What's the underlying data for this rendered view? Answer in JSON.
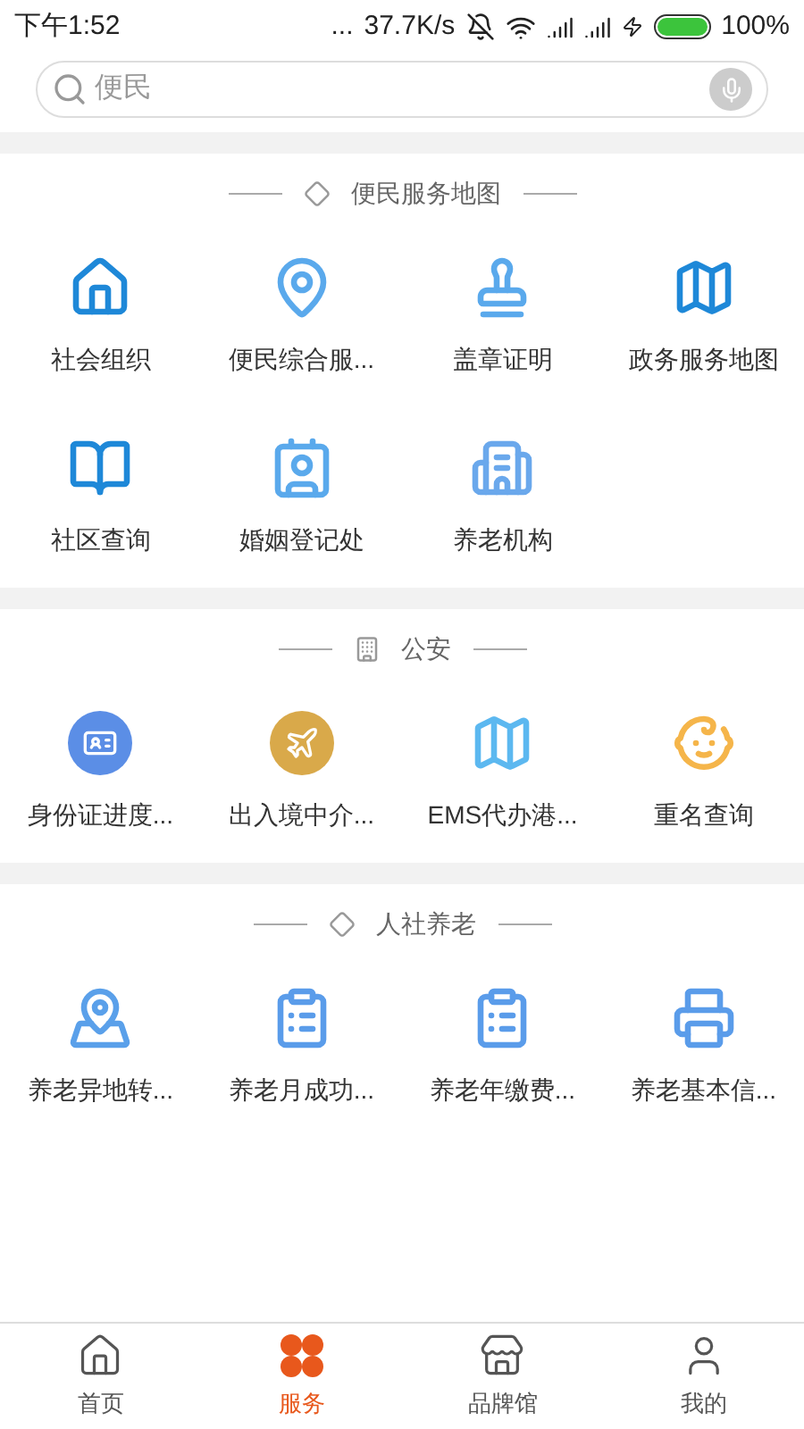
{
  "status_bar": {
    "time": "下午1:52",
    "dots": "...",
    "speed": "37.7K/s",
    "battery": "100%"
  },
  "search": {
    "placeholder": "便民"
  },
  "sections": [
    {
      "title": "便民服务地图",
      "items": [
        "社会组织",
        "便民综合服...",
        "盖章证明",
        "政务服务地图",
        "社区查询",
        "婚姻登记处",
        "养老机构"
      ]
    },
    {
      "title": "公安",
      "items": [
        "身份证进度...",
        "出入境中介...",
        "EMS代办港...",
        "重名查询"
      ]
    },
    {
      "title": "人社养老",
      "items": [
        "养老异地转...",
        "养老月成功...",
        "养老年缴费...",
        "养老基本信..."
      ]
    }
  ],
  "tab_bar": [
    {
      "label": "首页",
      "selected": false
    },
    {
      "label": "服务",
      "selected": true
    },
    {
      "label": "品牌馆",
      "selected": false
    },
    {
      "label": "我的",
      "selected": false
    }
  ]
}
